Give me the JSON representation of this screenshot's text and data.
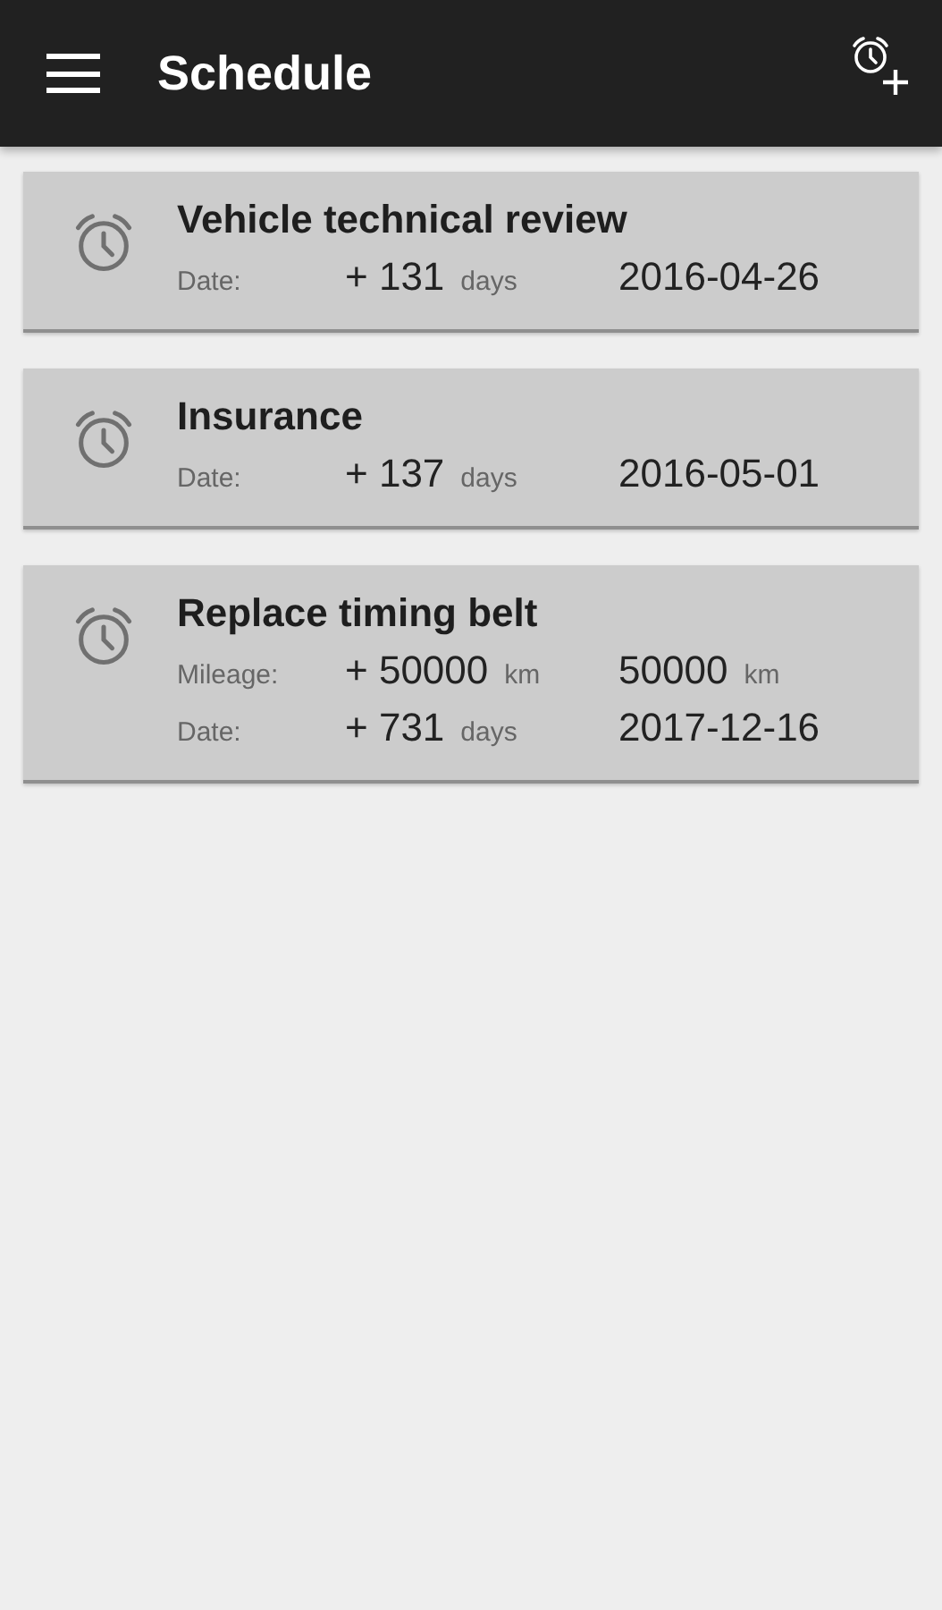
{
  "app_bar": {
    "title": "Schedule"
  },
  "reminders": [
    {
      "title": "Vehicle technical review",
      "rows": [
        {
          "label": "Date:",
          "delta": "+ 131",
          "delta_unit": "days",
          "target": "2016-04-26"
        }
      ]
    },
    {
      "title": "Insurance",
      "rows": [
        {
          "label": "Date:",
          "delta": "+ 137",
          "delta_unit": "days",
          "target": "2016-05-01"
        }
      ]
    },
    {
      "title": "Replace timing belt",
      "rows": [
        {
          "label": "Mileage:",
          "delta": "+ 50000",
          "delta_unit": "km",
          "target": "50000",
          "target_unit": "km"
        },
        {
          "label": "Date:",
          "delta": "+ 731",
          "delta_unit": "days",
          "target": "2017-12-16"
        }
      ]
    }
  ]
}
